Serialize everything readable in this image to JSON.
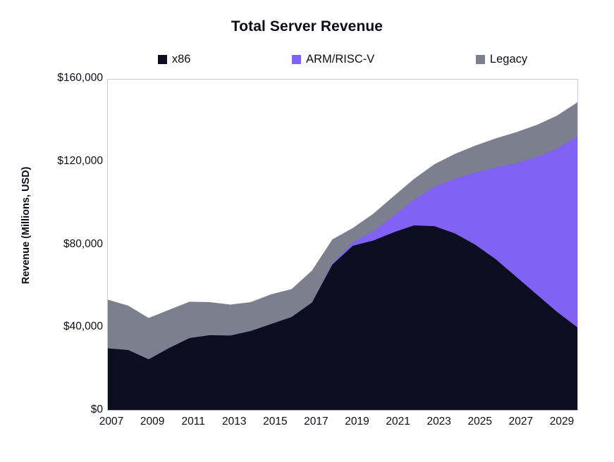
{
  "chart": {
    "title": "Total Server Revenue",
    "ylabel": "Revenue (Millions, USD)",
    "xlabel": ""
  },
  "legend": {
    "position": "top",
    "items": [
      {
        "label": "x86",
        "color": "#0d0d22",
        "swatch": "legend-swatch-x86"
      },
      {
        "label": "ARM/RISC-V",
        "color": "#8162f4",
        "swatch": "legend-swatch-arm-riscv"
      },
      {
        "label": "Legacy",
        "color": "#7b7f8e",
        "swatch": "legend-swatch-legacy"
      }
    ]
  },
  "y_axis": {
    "ticks": [
      "$0",
      "$40,000",
      "$80,000",
      "$120,000",
      "$160,000"
    ]
  },
  "x_axis": {
    "ticks": [
      "2007",
      "2009",
      "2011",
      "2013",
      "2015",
      "2017",
      "2019",
      "2021",
      "2023",
      "2025",
      "2027",
      "2029"
    ]
  },
  "chart_data": {
    "type": "area",
    "stacked": true,
    "title": "Total Server Revenue",
    "xlabel": "",
    "ylabel": "Revenue (Millions, USD)",
    "ylim": [
      0,
      160000
    ],
    "xlim": [
      2007,
      2030
    ],
    "grid": false,
    "legend_position": "top",
    "x": [
      2007,
      2008,
      2009,
      2010,
      2011,
      2012,
      2013,
      2014,
      2015,
      2016,
      2017,
      2018,
      2019,
      2020,
      2021,
      2022,
      2023,
      2024,
      2025,
      2026,
      2027,
      2028,
      2029,
      2030
    ],
    "categories": [
      "2007",
      "2008",
      "2009",
      "2010",
      "2011",
      "2012",
      "2013",
      "2014",
      "2015",
      "2016",
      "2017",
      "2018",
      "2019",
      "2020",
      "2021",
      "2022",
      "2023",
      "2024",
      "2025",
      "2026",
      "2027",
      "2028",
      "2029",
      "2030"
    ],
    "series": [
      {
        "name": "x86",
        "color": "#0d0d22",
        "values": [
          29800,
          29000,
          24500,
          30000,
          34800,
          36200,
          36000,
          38200,
          41600,
          45000,
          52000,
          70400,
          79500,
          82000,
          86000,
          89400,
          89000,
          85500,
          80000,
          73000,
          64500,
          56000,
          47500,
          40000
        ]
      },
      {
        "name": "ARM/RISC-V",
        "color": "#8162f4",
        "values": [
          0,
          0,
          0,
          0,
          0,
          0,
          0,
          0,
          0,
          0,
          0,
          400,
          1600,
          4500,
          8000,
          12500,
          19000,
          26500,
          35000,
          44500,
          55000,
          66500,
          79000,
          92500
        ]
      },
      {
        "name": "Legacy",
        "color": "#7b7f8e",
        "values": [
          23600,
          21500,
          20000,
          18500,
          17600,
          16000,
          15000,
          14000,
          14400,
          13500,
          15500,
          11800,
          7000,
          8500,
          9500,
          10000,
          11000,
          12000,
          13000,
          14000,
          15000,
          15500,
          16000,
          16500
        ]
      }
    ],
    "totals": [
      53400,
      50500,
      44500,
      48500,
      52400,
      52200,
      51000,
      52200,
      56000,
      58500,
      67500,
      82600,
      88100,
      95000,
      103500,
      111900,
      119000,
      124000,
      128000,
      131500,
      134500,
      138000,
      142500,
      149000
    ]
  }
}
